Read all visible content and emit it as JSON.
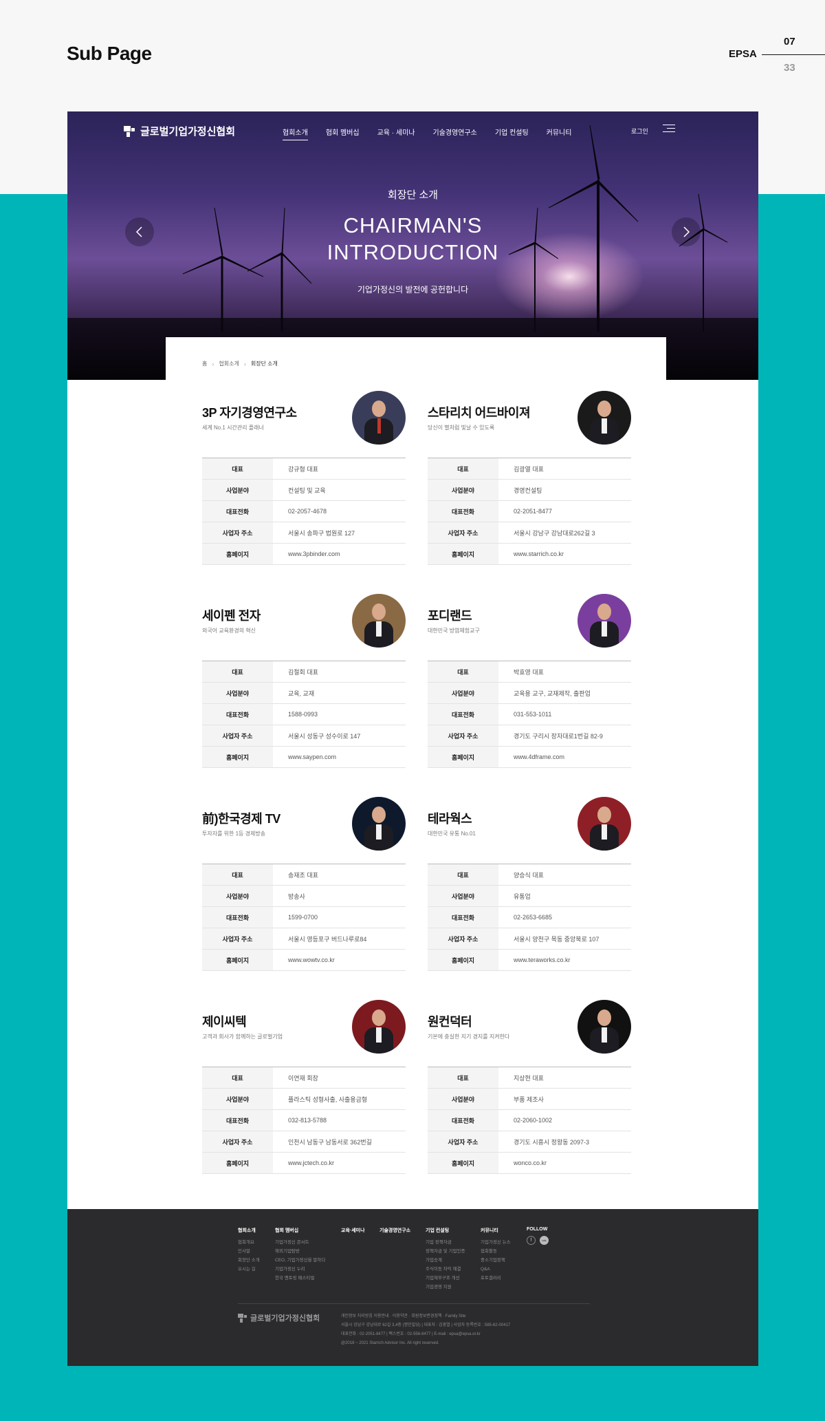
{
  "slide": {
    "title": "Sub Page",
    "brand": "EPSA",
    "current_page": "07",
    "total_pages": "33"
  },
  "colors": {
    "teal": "#00b5b8",
    "frame_bg": "#f7f7f7",
    "footer_bg": "#2b2b2d"
  },
  "header": {
    "logo_text": "글로벌기업가정신협회",
    "nav": [
      "협회소개",
      "협회 멤버십",
      "교육 · 세미나",
      "기술경영연구소",
      "기업 컨설팅",
      "커뮤니티"
    ],
    "active_nav": "협회소개",
    "login": "로그인",
    "menu_icon": "hamburger-icon"
  },
  "hero": {
    "subtitle": "회장단 소개",
    "title_line1": "CHAIRMAN'S",
    "title_line2": "INTRODUCTION",
    "description": "기업가정신의 발전에 공헌합니다",
    "prev_icon": "chevron-left-icon",
    "next_icon": "chevron-right-icon"
  },
  "breadcrumb": {
    "home": "홈",
    "parent": "협회소개",
    "current": "회장단 소개"
  },
  "labels": {
    "rep": "대표",
    "field": "사업분야",
    "phone": "대표전화",
    "address": "사업자 주소",
    "homepage": "홈페이지"
  },
  "members": [
    {
      "name": "3P 자기경영연구소",
      "slogan": "세계 No.1 시간관리 플래너",
      "rep": "강규형 대표",
      "field": "컨설팅 및 교육",
      "phone": "02-2057-4678",
      "address": "서울시 송파구 법원로 127",
      "homepage": "www.3pbinder.com"
    },
    {
      "name": "스타리치 어드바이져",
      "slogan": "당신이 별처럼 빛날 수 있도록",
      "rep": "김광열 대표",
      "field": "경영컨설팅",
      "phone": "02-2051-8477",
      "address": "서울시 강남구 강남대로262길 3",
      "homepage": "www.starrich.co.kr"
    },
    {
      "name": "세이펜 전자",
      "slogan": "외국어 교육환경의 혁신",
      "rep": "김철회 대표",
      "field": "교육, 교재",
      "phone": "1588-0993",
      "address": "서울시 성동구 성수이로 147",
      "homepage": "www.saypen.com"
    },
    {
      "name": "포디랜드",
      "slogan": "대한민국 방염체험교구",
      "rep": "박효영 대표",
      "field": "교육용 교구, 교재제작, 출판업",
      "phone": "031-553-1011",
      "address": "경기도 구리시 장자대로1번길 82-9",
      "homepage": "www.4dframe.com"
    },
    {
      "name": "前)한국경제 TV",
      "slogan": "투자자를 위한 1등 경제방송",
      "rep": "송재조 대표",
      "field": "방송사",
      "phone": "1599-0700",
      "address": "서울시 영등포구 버드나루로84",
      "homepage": "www.wowtv.co.kr"
    },
    {
      "name": "테라웍스",
      "slogan": "대한민국 유통 No.01",
      "rep": "양승식 대표",
      "field": "유통업",
      "phone": "02-2653-6685",
      "address": "서울시 양천구 목동 중앙북로 107",
      "homepage": "www.teraworks.co.kr"
    },
    {
      "name": "제이씨텍",
      "slogan": "고객과 회사가 함께하는 글로벌기업",
      "rep": "이연재 회장",
      "field": "플라스틱 성형사출, 사출용금형",
      "phone": "032-813-5788",
      "address": "인천시 남동구 남동서로 362번길",
      "homepage": "www.jctech.co.kr"
    },
    {
      "name": "원컨덕터",
      "slogan": "기본에 충실한 지기 경지를 지켜한다",
      "rep": "지상현 대표",
      "field": "부품 제조사",
      "phone": "02-2060-1002",
      "address": "경기도 시흥시 정왕동 2097-3",
      "homepage": "wonco.co.kr"
    }
  ],
  "footer": {
    "columns": [
      {
        "title": "협회소개",
        "items": [
          "협회개요",
          "인사말",
          "회장단 소개",
          "오시는 길"
        ]
      },
      {
        "title": "협회 멤버십",
        "items": [
          "기업가정신 콘서트",
          "해외기업탐방",
          "CEO, 기업가정신을 말하다",
          "기업가정신 누리",
          "한국 멘토링 페스티벌"
        ]
      },
      {
        "title": "교육·세미나",
        "items": []
      },
      {
        "title": "기술경영연구소",
        "items": []
      },
      {
        "title": "기업 컨설팅",
        "items": [
          "기업 정책자금",
          "정책자금 및 기업인증",
          "가업승계",
          "주식이동 차익 해결",
          "기업재무구조 개선",
          "기업경영 지원"
        ]
      },
      {
        "title": "커뮤니티",
        "items": [
          "기업가정신 뉴스",
          "협회활동",
          "중소기업정책",
          "Q&A",
          "포토갤러리"
        ]
      },
      {
        "title": "FOLLOW",
        "items": []
      }
    ],
    "follow_icons": [
      "facebook-icon",
      "kakaotalk-icon"
    ],
    "facebook_glyph": "f",
    "talk_glyph": "talk",
    "logo_text": "글로벌기업가정신협회",
    "info_lines": [
      "개인정보 처리방침 이용안내 · 이용약관 · 회원정보변경정책 · Family Site",
      "서울시 강남구 강남대로 62길 3,4층 (명인빌딩) | 대표자 : 김광열 | 사업자 등록번호 : 585-82-00417",
      "대표전화 : 02-2051-8477 | 팩스번호 : 02-556-8477 | E-mail : epsa@epsa.or.kr",
      "@2018 ~ 2021 Starrich Advisor Inc. All right reserved."
    ]
  }
}
